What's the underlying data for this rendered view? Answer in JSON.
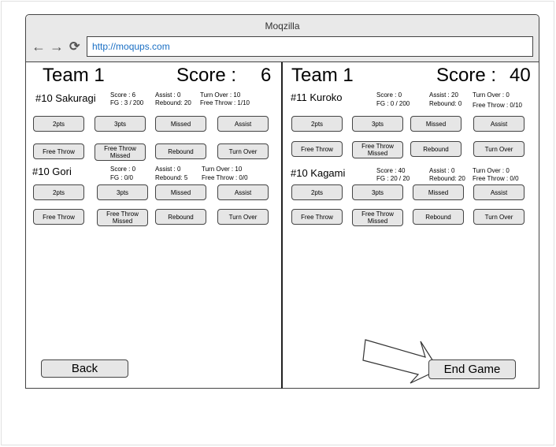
{
  "window": {
    "title": "Moqzilla",
    "url": "http://moqups.com"
  },
  "left": {
    "team": "Team 1",
    "score_label": "Score :",
    "score_value": "6",
    "players": [
      {
        "name": "#10 Sakuragi",
        "stats": {
          "score": "Score : 6",
          "fg": "FG : 3 / 200",
          "assist": "Assist : 0",
          "rebound": "Rebound: 20",
          "turnover": "Turn Over : 10",
          "freethrow": "Free Throw : 1/10"
        }
      },
      {
        "name": "#10 Gori",
        "stats": {
          "score": "Score : 0",
          "fg": "FG : 0/0",
          "assist": "Assist : 0",
          "rebound": "Rebound: 5",
          "turnover": "Turn Over : 10",
          "freethrow": "Free Throw : 0/0"
        }
      }
    ],
    "back_label": "Back"
  },
  "right": {
    "team": "Team 1",
    "score_label": "Score :",
    "score_value": "40",
    "players": [
      {
        "name": "#11 Kuroko",
        "stats": {
          "score": "Score : 0",
          "fg": "FG : 0 / 200",
          "assist": "Assist : 20",
          "rebound": "Rebound: 0",
          "turnover": "Turn Over : 0",
          "freethrow": "Free Throw : 0/10"
        }
      },
      {
        "name": "#10 Kagami",
        "stats": {
          "score": "Score : 40",
          "fg": "FG : 20 / 20",
          "assist": "Assist : 0",
          "rebound": "Rebound: 20",
          "turnover": "Turn Over : 0",
          "freethrow": "Free Throw : 0/0"
        }
      }
    ],
    "end_label": "End Game"
  },
  "actions": {
    "two": "2pts",
    "three": "3pts",
    "missed": "Missed",
    "assist": "Assist",
    "freethrow": "Free Throw",
    "ft_missed": "Free Throw Missed",
    "rebound": "Rebound",
    "turnover": "Turn Over"
  },
  "icons": {
    "back": "arrow-left-icon",
    "forward": "arrow-right-icon",
    "reload": "reload-icon",
    "pointer": "arrow-outline-icon"
  }
}
